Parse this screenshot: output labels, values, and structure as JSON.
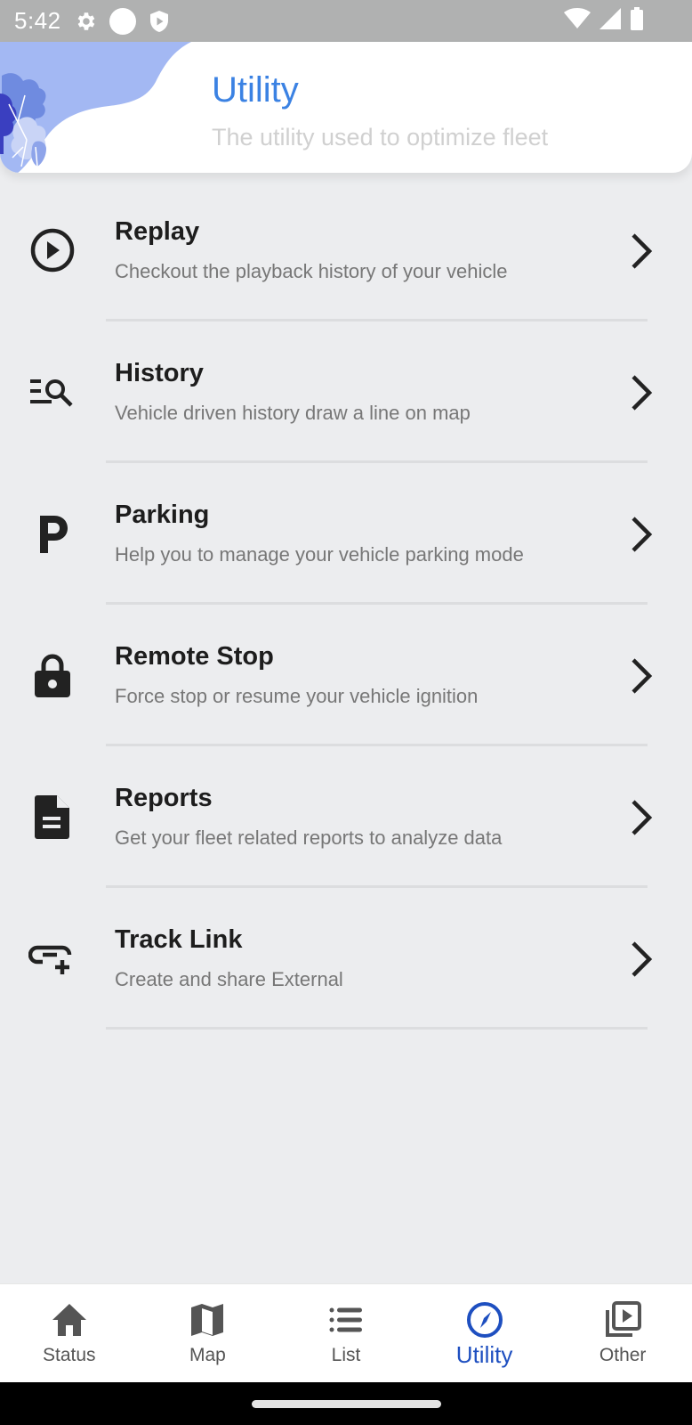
{
  "status_bar": {
    "time": "5:42",
    "left_icons": [
      "gear-icon",
      "circle-icon",
      "shield-play-icon"
    ],
    "right_icons": [
      "wifi-icon",
      "cell-signal-icon",
      "battery-icon"
    ]
  },
  "header": {
    "title": "Utility",
    "subtitle": "The utility used to optimize fleet",
    "title_color": "#3b82e3",
    "art_color": "#a3b8f3"
  },
  "menu": {
    "items": [
      {
        "icon": "play-circle-icon",
        "label": "Replay",
        "description": "Checkout the playback history of your vehicle"
      },
      {
        "icon": "list-search-icon",
        "label": "History",
        "description": "Vehicle driven history draw a line on map"
      },
      {
        "icon": "parking-icon",
        "label": "Parking",
        "description": "Help you to manage your vehicle parking mode"
      },
      {
        "icon": "lock-icon",
        "label": "Remote Stop",
        "description": "Force stop or resume your vehicle ignition"
      },
      {
        "icon": "document-icon",
        "label": "Reports",
        "description": "Get your fleet related reports to analyze data"
      },
      {
        "icon": "add-link-icon",
        "label": "Track Link",
        "description": "Create and share External"
      }
    ]
  },
  "bottom_nav": {
    "active_color": "#1e4fc0",
    "items": [
      {
        "icon": "home-icon",
        "label": "Status",
        "active": false
      },
      {
        "icon": "map-icon",
        "label": "Map",
        "active": false
      },
      {
        "icon": "list-icon",
        "label": "List",
        "active": false
      },
      {
        "icon": "compass-icon",
        "label": "Utility",
        "active": true
      },
      {
        "icon": "video-library-icon",
        "label": "Other",
        "active": false
      }
    ]
  }
}
